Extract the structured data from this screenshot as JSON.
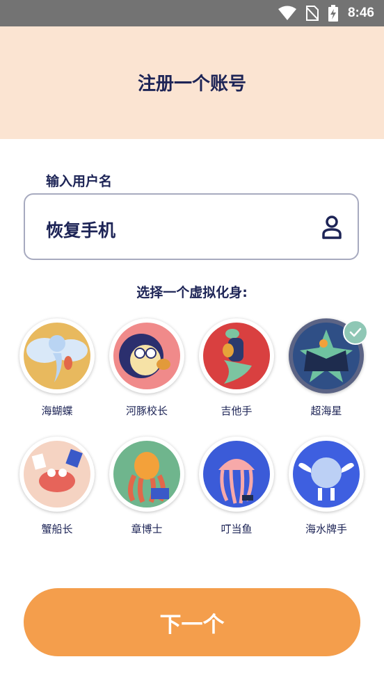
{
  "status_bar": {
    "time": "8:46"
  },
  "header": {
    "title": "注册一个账号"
  },
  "username": {
    "label": "输入用户名",
    "value": "恢复手机"
  },
  "avatar_section": {
    "prompt": "选择一个虚拟化身:",
    "selected_index": 3,
    "avatars": [
      {
        "name": "海蝴蝶",
        "bg": "#e8b95e"
      },
      {
        "name": "河豚校长",
        "bg": "#f08a8a"
      },
      {
        "name": "吉他手",
        "bg": "#d94040"
      },
      {
        "name": "超海星",
        "bg": "#2f4f86"
      },
      {
        "name": "蟹船长",
        "bg": "#f5d3c2"
      },
      {
        "name": "章博士",
        "bg": "#6fb58d"
      },
      {
        "name": "叮当鱼",
        "bg": "#3b5bd8"
      },
      {
        "name": "海水牌手",
        "bg": "#3e5fe0"
      }
    ]
  },
  "footer": {
    "next_label": "下一个"
  }
}
